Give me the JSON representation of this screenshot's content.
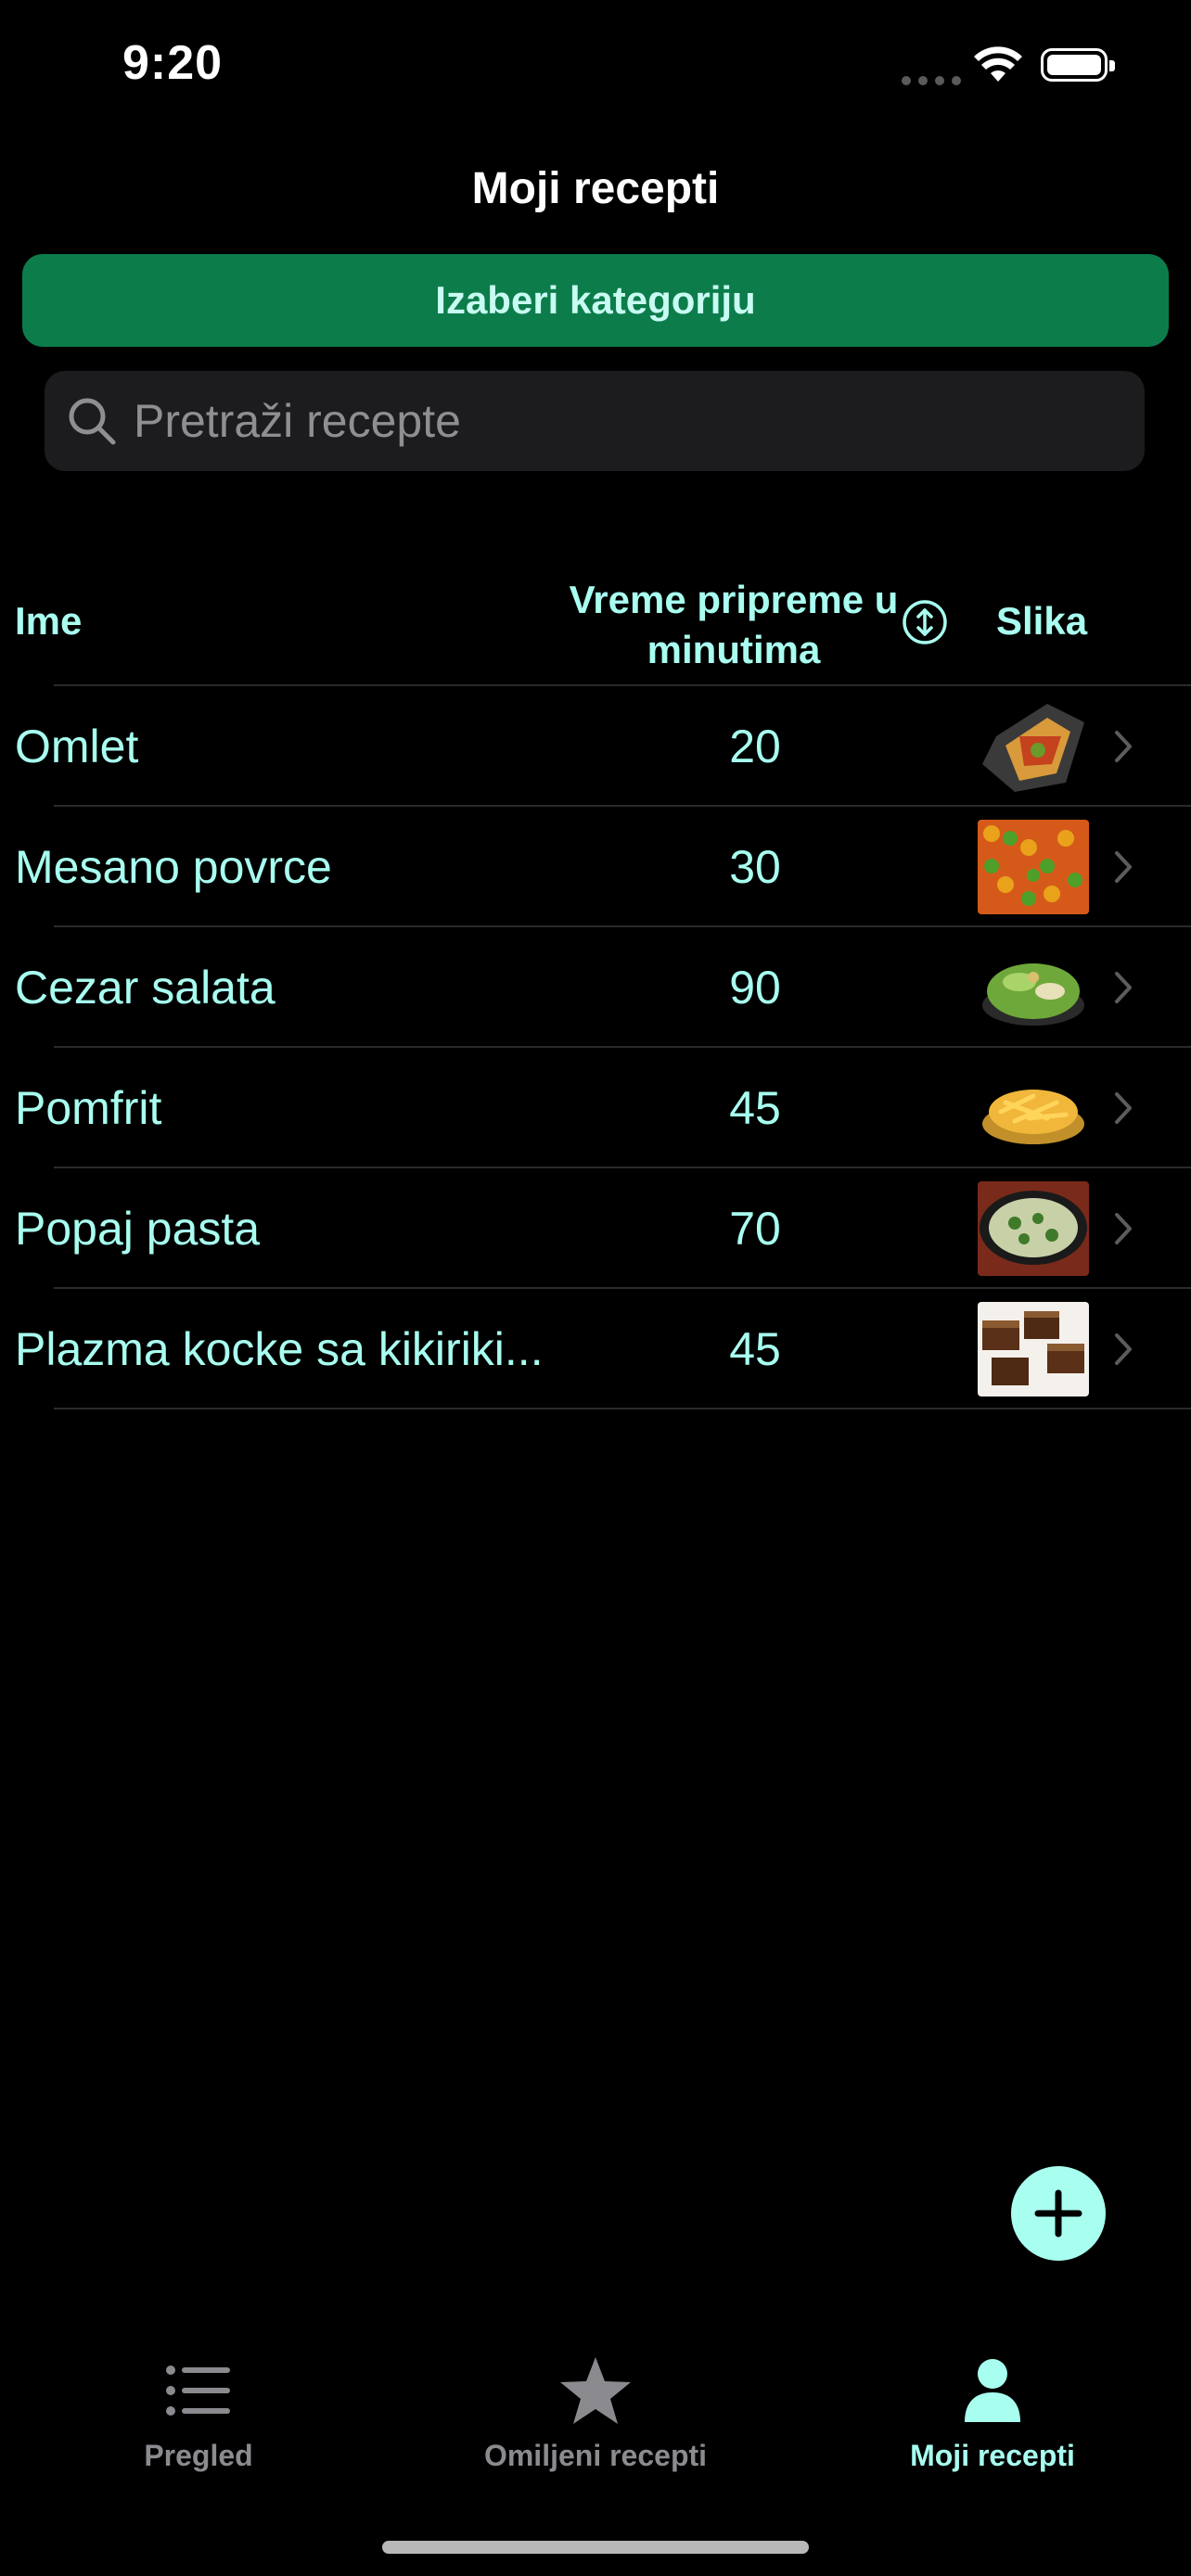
{
  "status_bar": {
    "time": "9:20"
  },
  "nav": {
    "title": "Moji recepti"
  },
  "category_button": {
    "label": "Izaberi kategoriju"
  },
  "search": {
    "placeholder": "Pretraži recepte"
  },
  "table": {
    "headers": {
      "name": "Ime",
      "time": "Vreme pripreme u minutima",
      "image": "Slika"
    },
    "rows": [
      {
        "name": "Omlet",
        "time": "20"
      },
      {
        "name": "Mesano povrce",
        "time": "30"
      },
      {
        "name": "Cezar salata",
        "time": "90"
      },
      {
        "name": "Pomfrit",
        "time": "45"
      },
      {
        "name": "Popaj pasta",
        "time": "70"
      },
      {
        "name": "Plazma kocke sa kikiriki...",
        "time": "45"
      }
    ]
  },
  "tabs": [
    {
      "label": "Pregled",
      "icon": "list-icon"
    },
    {
      "label": "Omiljeni recepti",
      "icon": "star-icon"
    },
    {
      "label": "Moji recepti",
      "icon": "person-icon",
      "active": true
    }
  ],
  "colors": {
    "accent": "#a8fff0",
    "button": "#0d7c4b",
    "background": "#000000"
  }
}
